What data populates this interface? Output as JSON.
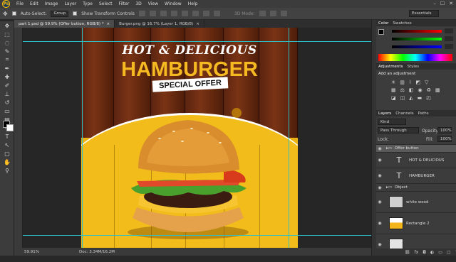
{
  "menubar": {
    "logo": "Ps",
    "items": [
      "File",
      "Edit",
      "Image",
      "Layer",
      "Type",
      "Select",
      "Filter",
      "3D",
      "View",
      "Window",
      "Help"
    ],
    "window_controls": [
      "–",
      "☐",
      "✕"
    ]
  },
  "options": {
    "auto_select_label": "Auto-Select:",
    "auto_select_value": "Group",
    "transform_label": "Show Transform Controls",
    "mode_label": "3D Mode:",
    "workspace": "Essentials"
  },
  "tabs": [
    {
      "label": "part 1.psd @ 59.9% (Offer button, RGB/8) *",
      "close": "×"
    },
    {
      "label": "Burger.png @ 16.7% (Layer 1, RGB/8)",
      "close": "×"
    }
  ],
  "artwork": {
    "line1": "HOT & DELICIOUS",
    "line2": "HAMBURGER",
    "badge": "SPECIAL OFFER"
  },
  "status": {
    "zoom": "59.91%",
    "doc": "Doc: 3.34M/16.2M"
  },
  "color_panel": {
    "tabs": [
      "Color",
      "Swatches"
    ]
  },
  "adjustments": {
    "tabs": [
      "Adjustments",
      "Styles"
    ],
    "hint": "Add an adjustment"
  },
  "layers_panel": {
    "tabs": [
      "Layers",
      "Channels",
      "Paths"
    ],
    "kind": "Kind",
    "blend": "Pass Through",
    "opacity_label": "Opacity:",
    "opacity_value": "100%",
    "lock_label": "Lock:",
    "fill_label": "Fill:",
    "fill_value": "100%",
    "layers": [
      {
        "name": "Offer button",
        "kind": "group"
      },
      {
        "name": "HOT & DELICIOUS",
        "kind": "text"
      },
      {
        "name": "HAMBURGER",
        "kind": "text"
      },
      {
        "name": "Object",
        "kind": "group"
      },
      {
        "name": "white wood",
        "kind": "image"
      },
      {
        "name": "Rectangle 2",
        "kind": "shape"
      }
    ]
  }
}
